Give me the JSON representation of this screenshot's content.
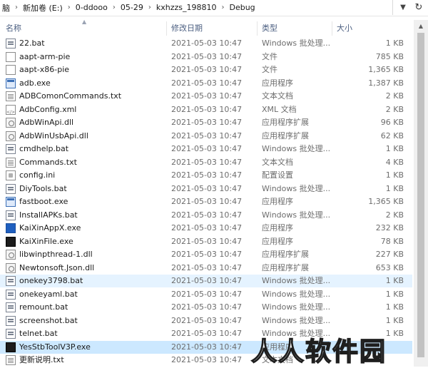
{
  "breadcrumb": [
    "脑",
    "新加卷 (E:)",
    "0-ddooo",
    "05-29",
    "kxhzzs_198810",
    "Debug"
  ],
  "columns": {
    "name": "名称",
    "date": "修改日期",
    "type": "类型",
    "size": "大小"
  },
  "files": [
    {
      "name": "22.bat",
      "date": "2021-05-03 10:47",
      "type": "Windows 批处理...",
      "size": "1 KB",
      "icon": "bat"
    },
    {
      "name": "aapt-arm-pie",
      "date": "2021-05-03 10:47",
      "type": "文件",
      "size": "785 KB",
      "icon": "file"
    },
    {
      "name": "aapt-x86-pie",
      "date": "2021-05-03 10:47",
      "type": "文件",
      "size": "1,365 KB",
      "icon": "file"
    },
    {
      "name": "adb.exe",
      "date": "2021-05-03 10:47",
      "type": "应用程序",
      "size": "1,387 KB",
      "icon": "exe"
    },
    {
      "name": "ADBComonCommands.txt",
      "date": "2021-05-03 10:47",
      "type": "文本文档",
      "size": "2 KB",
      "icon": "txt"
    },
    {
      "name": "AdbConfig.xml",
      "date": "2021-05-03 10:47",
      "type": "XML 文档",
      "size": "2 KB",
      "icon": "xml"
    },
    {
      "name": "AdbWinApi.dll",
      "date": "2021-05-03 10:47",
      "type": "应用程序扩展",
      "size": "96 KB",
      "icon": "dll"
    },
    {
      "name": "AdbWinUsbApi.dll",
      "date": "2021-05-03 10:47",
      "type": "应用程序扩展",
      "size": "62 KB",
      "icon": "dll"
    },
    {
      "name": "cmdhelp.bat",
      "date": "2021-05-03 10:47",
      "type": "Windows 批处理...",
      "size": "1 KB",
      "icon": "bat"
    },
    {
      "name": "Commands.txt",
      "date": "2021-05-03 10:47",
      "type": "文本文档",
      "size": "4 KB",
      "icon": "txt"
    },
    {
      "name": "config.ini",
      "date": "2021-05-03 10:47",
      "type": "配置设置",
      "size": "1 KB",
      "icon": "ini"
    },
    {
      "name": "DiyTools.bat",
      "date": "2021-05-03 10:47",
      "type": "Windows 批处理...",
      "size": "1 KB",
      "icon": "bat"
    },
    {
      "name": "fastboot.exe",
      "date": "2021-05-03 10:47",
      "type": "应用程序",
      "size": "1,365 KB",
      "icon": "exe"
    },
    {
      "name": "InstallAPKs.bat",
      "date": "2021-05-03 10:47",
      "type": "Windows 批处理...",
      "size": "2 KB",
      "icon": "bat"
    },
    {
      "name": "KaiXinAppX.exe",
      "date": "2021-05-03 10:47",
      "type": "应用程序",
      "size": "232 KB",
      "icon": "exe-blue"
    },
    {
      "name": "KaiXinFile.exe",
      "date": "2021-05-03 10:47",
      "type": "应用程序",
      "size": "78 KB",
      "icon": "exe-dark"
    },
    {
      "name": "libwinpthread-1.dll",
      "date": "2021-05-03 10:47",
      "type": "应用程序扩展",
      "size": "227 KB",
      "icon": "dll"
    },
    {
      "name": "Newtonsoft.Json.dll",
      "date": "2021-05-03 10:47",
      "type": "应用程序扩展",
      "size": "653 KB",
      "icon": "dll"
    },
    {
      "name": "onekey3798.bat",
      "date": "2021-05-03 10:47",
      "type": "Windows 批处理...",
      "size": "1 KB",
      "icon": "bat"
    },
    {
      "name": "onekeyaml.bat",
      "date": "2021-05-03 10:47",
      "type": "Windows 批处理...",
      "size": "1 KB",
      "icon": "bat"
    },
    {
      "name": "remount.bat",
      "date": "2021-05-03 10:47",
      "type": "Windows 批处理...",
      "size": "1 KB",
      "icon": "bat"
    },
    {
      "name": "screenshot.bat",
      "date": "2021-05-03 10:47",
      "type": "Windows 批处理...",
      "size": "1 KB",
      "icon": "bat"
    },
    {
      "name": "telnet.bat",
      "date": "2021-05-03 10:47",
      "type": "Windows 批处理...",
      "size": "1 KB",
      "icon": "bat"
    },
    {
      "name": "YesStbToolV3P.exe",
      "date": "2021-05-03 10:47",
      "type": "应用程序",
      "size": "",
      "icon": "exe-dark"
    },
    {
      "name": "更新说明.txt",
      "date": "2021-05-03 10:47",
      "type": "文本文档",
      "size": "",
      "icon": "txt"
    }
  ],
  "row_states": {
    "18": "hover",
    "23": "sel"
  },
  "watermark": "人人软件园"
}
